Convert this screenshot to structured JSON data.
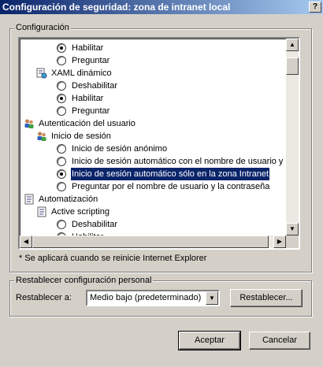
{
  "window": {
    "title": "Configuración de seguridad: zona de intranet local",
    "help_label": "?"
  },
  "settings_group": {
    "label": "Configuración"
  },
  "tree": [
    {
      "type": "radio",
      "level": 2,
      "label": "Habilitar",
      "checked": true,
      "selected": false
    },
    {
      "type": "radio",
      "level": 2,
      "label": "Preguntar",
      "checked": false,
      "selected": false
    },
    {
      "type": "category",
      "level": 1,
      "icon": "script-gear-icon",
      "label": "XAML dinámico"
    },
    {
      "type": "radio",
      "level": 2,
      "label": "Deshabilitar",
      "checked": false,
      "selected": false
    },
    {
      "type": "radio",
      "level": 2,
      "label": "Habilitar",
      "checked": true,
      "selected": false
    },
    {
      "type": "radio",
      "level": 2,
      "label": "Preguntar",
      "checked": false,
      "selected": false
    },
    {
      "type": "category",
      "level": 0,
      "icon": "users-icon",
      "label": "Autenticación del usuario"
    },
    {
      "type": "category",
      "level": 1,
      "icon": "users-icon",
      "label": "Inicio de sesión"
    },
    {
      "type": "radio",
      "level": 2,
      "label": "Inicio de sesión anónimo",
      "checked": false,
      "selected": false
    },
    {
      "type": "radio",
      "level": 2,
      "label": "Inicio de sesión automático con el nombre de usuario y co",
      "checked": false,
      "selected": false
    },
    {
      "type": "radio",
      "level": 2,
      "label": "Inicio de sesión automático sólo en la zona Intranet",
      "checked": true,
      "selected": true
    },
    {
      "type": "radio",
      "level": 2,
      "label": "Preguntar por el nombre de usuario y la contraseña",
      "checked": false,
      "selected": false
    },
    {
      "type": "category",
      "level": 0,
      "icon": "script-icon",
      "label": "Automatización"
    },
    {
      "type": "category",
      "level": 1,
      "icon": "script-icon",
      "label": "Active scripting"
    },
    {
      "type": "radio",
      "level": 2,
      "label": "Deshabilitar",
      "checked": false,
      "selected": false
    },
    {
      "type": "radio",
      "level": 2,
      "label": "Habilitar",
      "checked": true,
      "selected": false
    }
  ],
  "note": "* Se aplicará cuando se reinicie Internet Explorer",
  "reset_group": {
    "label": "Restablecer configuración personal",
    "reset_to_label": "Restablecer a:",
    "level_value": "Medio bajo (predeterminado)",
    "reset_button": "Restablecer..."
  },
  "footer": {
    "ok_button": "Aceptar",
    "cancel_button": "Cancelar"
  }
}
